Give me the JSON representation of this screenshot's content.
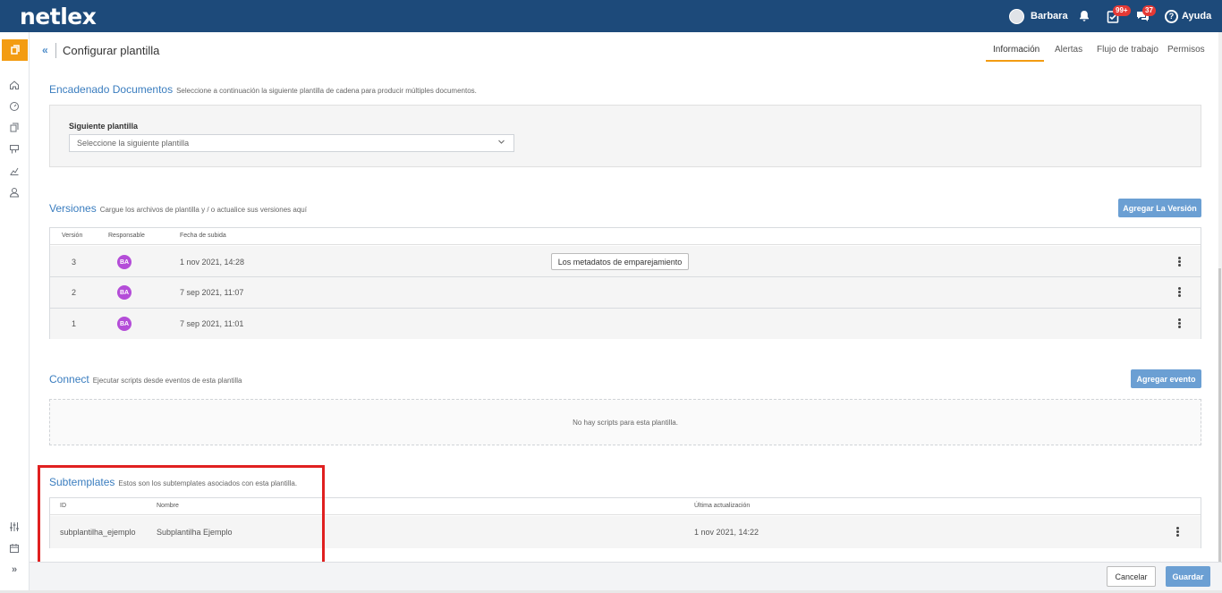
{
  "app": {
    "logo": "netlex"
  },
  "topbar": {
    "user_name": "Barbara",
    "tasks_badge": "99+",
    "messages_badge": "37",
    "help_label": "Ayuda"
  },
  "header": {
    "back": "«",
    "title": "Configurar plantilla",
    "tabs": [
      {
        "label": "Información",
        "active": true
      },
      {
        "label": "Alertas"
      },
      {
        "label": "Flujo de trabajo"
      },
      {
        "label": "Permisos"
      }
    ]
  },
  "chaining": {
    "title": "Encadenado Documentos",
    "subtitle": "Seleccione a continuación la siguiente plantilla de cadena para producir múltiples documentos.",
    "field_label": "Siguiente plantilla",
    "select_placeholder": "Seleccione la siguiente plantilla"
  },
  "versions": {
    "title": "Versiones",
    "subtitle": "Cargue los archivos de plantilla y / o actualice sus versiones aquí",
    "add_button": "Agregar La Versión",
    "columns": [
      "Versión",
      "Responsable",
      "Fecha de subida"
    ],
    "rows": [
      {
        "version": "3",
        "initials": "BA",
        "date": "1 nov 2021, 14:28",
        "metadata_button": "Los metadatos de emparejamiento"
      },
      {
        "version": "2",
        "initials": "BA",
        "date": "7 sep 2021, 11:07"
      },
      {
        "version": "1",
        "initials": "BA",
        "date": "7 sep 2021, 11:01"
      }
    ]
  },
  "connect": {
    "title": "Connect",
    "subtitle": "Ejecutar scripts desde eventos de esta plantilla",
    "add_button": "Agregar evento",
    "empty_text": "No hay scripts para esta plantilla."
  },
  "subtemplates": {
    "title": "Subtemplates",
    "subtitle": "Estos son los subtemplates asociados con esta plantilla.",
    "columns": [
      "ID",
      "Nombre",
      "Última actualización"
    ],
    "rows": [
      {
        "id": "subplantilha_ejemplo",
        "name": "Subplantilha Ejemplo",
        "updated": "1 nov 2021, 14:22"
      }
    ]
  },
  "footer": {
    "cancel": "Cancelar",
    "save": "Guardar"
  },
  "sidebar": {
    "expand": "»",
    "icons": [
      "template-icon",
      "home-icon",
      "dashboard-icon",
      "documents-icon",
      "boards-icon",
      "reports-icon",
      "user-icon",
      "settings-sliders-icon",
      "calendar-icon"
    ]
  },
  "colors": {
    "brand": "#1d4a7a",
    "accent": "#f39c12",
    "link": "#3a7dbf",
    "button": "#6b9fd3",
    "highlight": "#e02020"
  }
}
